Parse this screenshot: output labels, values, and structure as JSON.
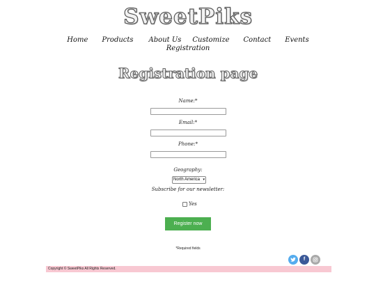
{
  "site": {
    "logo": "SweetPiks"
  },
  "nav": {
    "items": [
      {
        "label": "Home"
      },
      {
        "label": "Products"
      },
      {
        "label": "About Us"
      },
      {
        "label": "Customize"
      },
      {
        "label": "Contact"
      },
      {
        "label": "Events"
      },
      {
        "label": "Registration"
      }
    ]
  },
  "page": {
    "title": "Registration page"
  },
  "form": {
    "name_label": "Name:*",
    "name_value": "",
    "email_label": "Email:*",
    "email_value": "",
    "phone_label": "Phone:*",
    "phone_value": "",
    "geography_label": "Geography:",
    "geography_selected": "North America",
    "geography_caret": "▾",
    "newsletter_label": "Subscribe for our newsletter:",
    "newsletter_option": "Yes",
    "newsletter_checked": false,
    "submit_label": "Register now",
    "required_note": "*Required fields"
  },
  "social": {
    "twitter": {
      "icon": "twitter-icon",
      "color": "#55acee"
    },
    "facebook": {
      "icon": "facebook-icon",
      "color": "#3b5998",
      "glyph": "f"
    },
    "instagram": {
      "icon": "instagram-icon",
      "color": "#a9a9a9"
    }
  },
  "footer": {
    "copyright": "Copyright © SweetPiks All Rights Reserved.",
    "background": "#f8c8d2"
  },
  "colors": {
    "button": "#4caf50"
  }
}
